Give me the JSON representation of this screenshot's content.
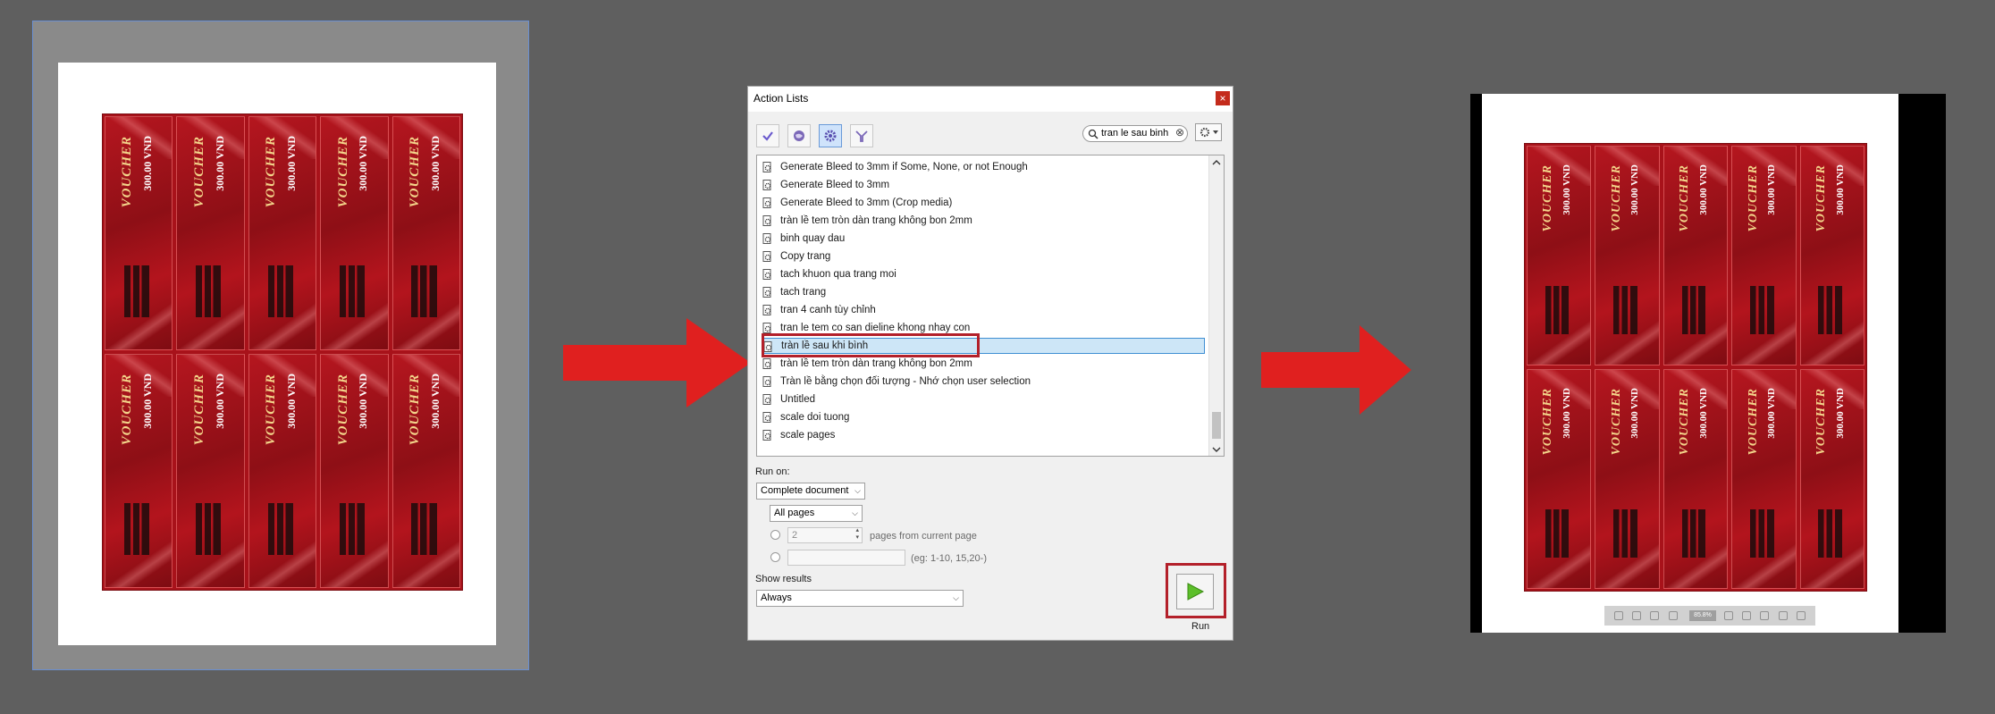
{
  "dialog": {
    "title": "Action Lists",
    "close_label": "×",
    "search": {
      "value": "tran le sau binh",
      "clear_label": "⊗"
    },
    "actions": [
      "Generate Bleed to 3mm if Some, None, or not Enough",
      "Generate Bleed to 3mm",
      "Generate Bleed to 3mm (Crop media)",
      "tràn lề tem tròn  dàn trang không bon 2mm",
      "binh quay dau",
      "Copy trang",
      "tach khuon qua trang moi",
      "tach trang",
      "tran 4 canh tùy chỉnh",
      "tran le tem co san dieline khong nhay con",
      "tràn lề sau khi bình",
      "tràn lề tem tròn  dàn trang không bon 2mm",
      "Tràn lề bằng chọn đối tượng - Nhớ chọn user selection",
      "Untitled",
      "scale doi tuong",
      "scale pages"
    ],
    "selected_index": 10,
    "run_on_label": "Run on:",
    "run_on_value": "Complete document",
    "pages_value": "All pages",
    "pages_count_value": "2",
    "pages_from_label": "pages from current page",
    "range_placeholder_label": "(eg: 1-10, 15,20-)",
    "show_results_label": "Show results",
    "show_results_value": "Always",
    "run_label": "Run"
  },
  "preview_right": {
    "zoom": "85.8%"
  },
  "voucher": {
    "brand_text": "VOUCHER",
    "amount_text": "300.00 VND"
  },
  "colors": {
    "accent_red": "#e0201f",
    "voucher_red": "#a8121a",
    "selection": "#cde6f7",
    "highlight_border": "#b3202a"
  }
}
